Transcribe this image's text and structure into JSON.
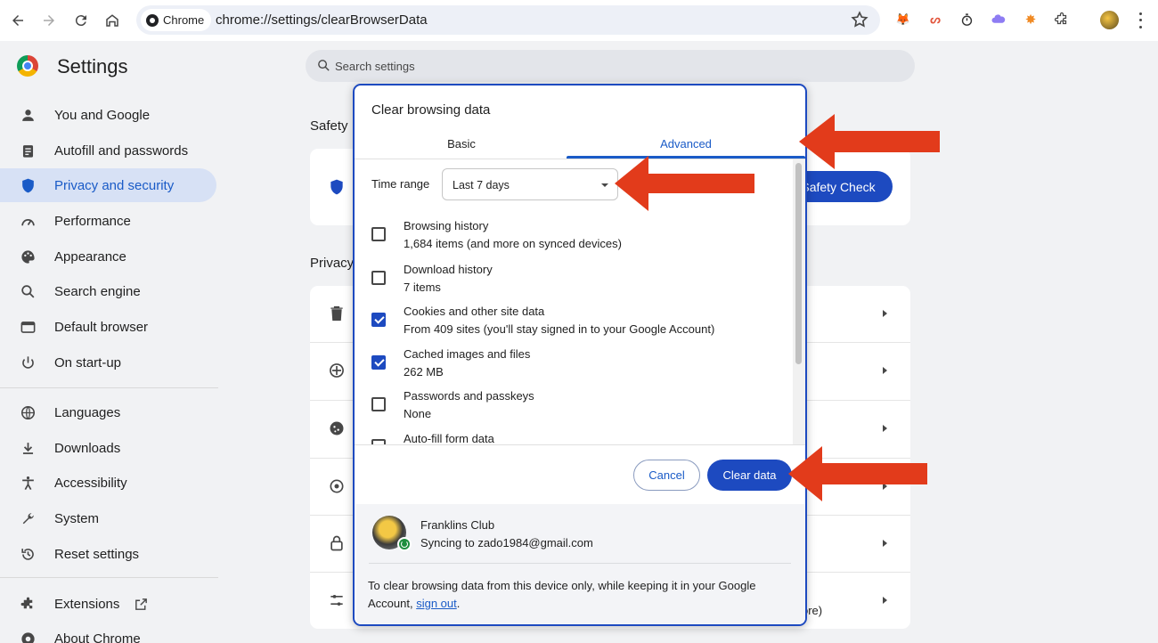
{
  "browser": {
    "chip_label": "Chrome",
    "url": "chrome://settings/clearBrowserData"
  },
  "settings": {
    "title": "Settings",
    "search_placeholder": "Search settings",
    "nav": [
      {
        "label": "You and Google",
        "icon": "person-icon"
      },
      {
        "label": "Autofill and passwords",
        "icon": "clipboard-icon"
      },
      {
        "label": "Privacy and security",
        "icon": "shield-icon",
        "active": true
      },
      {
        "label": "Performance",
        "icon": "speedometer-icon"
      },
      {
        "label": "Appearance",
        "icon": "palette-icon"
      },
      {
        "label": "Search engine",
        "icon": "search-icon"
      },
      {
        "label": "Default browser",
        "icon": "browser-window-icon"
      },
      {
        "label": "On start-up",
        "icon": "power-icon"
      },
      {
        "label": "Languages",
        "icon": "globe-icon"
      },
      {
        "label": "Downloads",
        "icon": "download-icon"
      },
      {
        "label": "Accessibility",
        "icon": "accessibility-icon"
      },
      {
        "label": "System",
        "icon": "wrench-icon"
      },
      {
        "label": "Reset settings",
        "icon": "reset-icon"
      },
      {
        "label": "Extensions",
        "icon": "puzzle-icon"
      },
      {
        "label": "About Chrome",
        "icon": "chrome-icon"
      }
    ],
    "safety_section_label": "Safety",
    "privacy_section_label": "Privacy",
    "safety_check_button": "Safety Check",
    "partial_more_text": "ore)"
  },
  "dialog": {
    "title": "Clear browsing data",
    "tabs": {
      "basic": "Basic",
      "advanced": "Advanced",
      "selected": "Advanced"
    },
    "time_range": {
      "label": "Time range",
      "value": "Last 7 days"
    },
    "items": [
      {
        "title": "Browsing history",
        "subtitle": "1,684 items (and more on synced devices)",
        "checked": false
      },
      {
        "title": "Download history",
        "subtitle": "7 items",
        "checked": false
      },
      {
        "title": "Cookies and other site data",
        "subtitle": "From 409 sites (you'll stay signed in to your Google Account)",
        "checked": true
      },
      {
        "title": "Cached images and files",
        "subtitle": "262 MB",
        "checked": true
      },
      {
        "title": "Passwords and passkeys",
        "subtitle": "None",
        "checked": false
      },
      {
        "title": "Auto-fill form data",
        "subtitle": "",
        "checked": false
      }
    ],
    "cancel_label": "Cancel",
    "clear_label": "Clear data",
    "account": {
      "name": "Franklins Club",
      "sync_text": "Syncing to zado1984@gmail.com"
    },
    "note_prefix": "To clear browsing data from this device only, while keeping it in your Google Account, ",
    "note_link": "sign out",
    "note_suffix": "."
  },
  "colors": {
    "accent": "#1a5bc7",
    "button_primary": "#1d4ac0",
    "annotation_arrow": "#e23b1b"
  }
}
